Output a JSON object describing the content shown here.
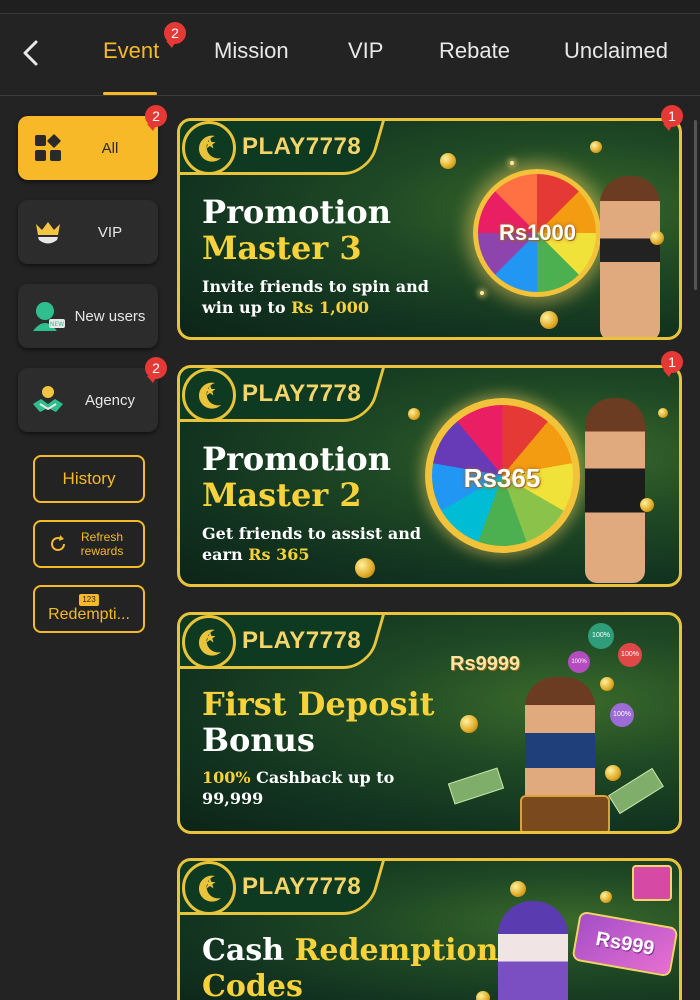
{
  "header": {
    "tabs": [
      {
        "label": "Event",
        "badge": "2",
        "active": true
      },
      {
        "label": "Mission"
      },
      {
        "label": "VIP"
      },
      {
        "label": "Rebate"
      },
      {
        "label": "Unclaimed"
      }
    ]
  },
  "sidebar": {
    "items": [
      {
        "label": "All",
        "badge": "2",
        "icon": "grid-icon",
        "active": true
      },
      {
        "label": "VIP",
        "icon": "crown-shield-icon"
      },
      {
        "label": "New users",
        "icon": "new-user-icon"
      },
      {
        "label": "Agency",
        "badge": "2",
        "icon": "handshake-icon"
      }
    ],
    "history_label": "History",
    "refresh_label": "Refresh rewards",
    "redemption_label": "Redempti...",
    "redemption_icon_text": "123"
  },
  "banners": [
    {
      "logo": "PLAY7778",
      "title_line1": "Promotion",
      "title_line2": "Master 3",
      "desc_prefix": "Invite friends to spin and win up to ",
      "desc_highlight": "Rs 1,000",
      "prize": "Rs1000",
      "badge": "1"
    },
    {
      "logo": "PLAY7778",
      "title_line1": "Promotion",
      "title_line2": "Master 2",
      "desc_prefix": "Get friends to assist and earn ",
      "desc_highlight": "Rs 365",
      "prize": "Rs365",
      "badge": "1"
    },
    {
      "logo": "PLAY7778",
      "title_line1": "First Deposit",
      "title_line2": "Bonus",
      "desc_highlight": "100%",
      "desc_suffix": " Cashback up to 99,999",
      "prize": "Rs9999",
      "chips": [
        "100%",
        "100%",
        "100%",
        "100%"
      ]
    },
    {
      "logo": "PLAY7778",
      "title_w": "Cash ",
      "title_y": "Redemption",
      "title_line2": "Codes",
      "prize": "Rs999"
    }
  ],
  "colors": {
    "accent": "#f7b928",
    "background": "#232323",
    "badge": "#e53935",
    "banner_border": "#e9c43b",
    "banner_green": "#123320"
  }
}
